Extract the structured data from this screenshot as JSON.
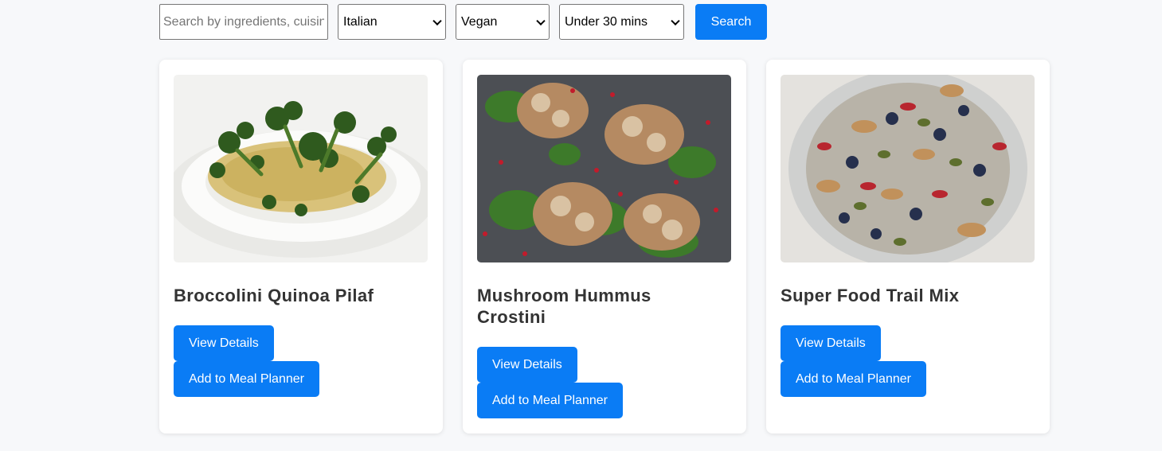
{
  "search": {
    "placeholder": "Search by ingredients, cuisine...",
    "cuisine": "Italian",
    "diet": "Vegan",
    "time": "Under 30 mins",
    "button_label": "Search"
  },
  "recipes": [
    {
      "title": "Broccolini Quinoa Pilaf",
      "details_label": "View Details",
      "planner_label": "Add to Meal Planner"
    },
    {
      "title": "Mushroom Hummus Crostini",
      "details_label": "View Details",
      "planner_label": "Add to Meal Planner"
    },
    {
      "title": "Super Food Trail Mix",
      "details_label": "View Details",
      "planner_label": "Add to Meal Planner"
    }
  ],
  "colors": {
    "accent": "#0a7cf5",
    "background": "#f7f8fa"
  }
}
